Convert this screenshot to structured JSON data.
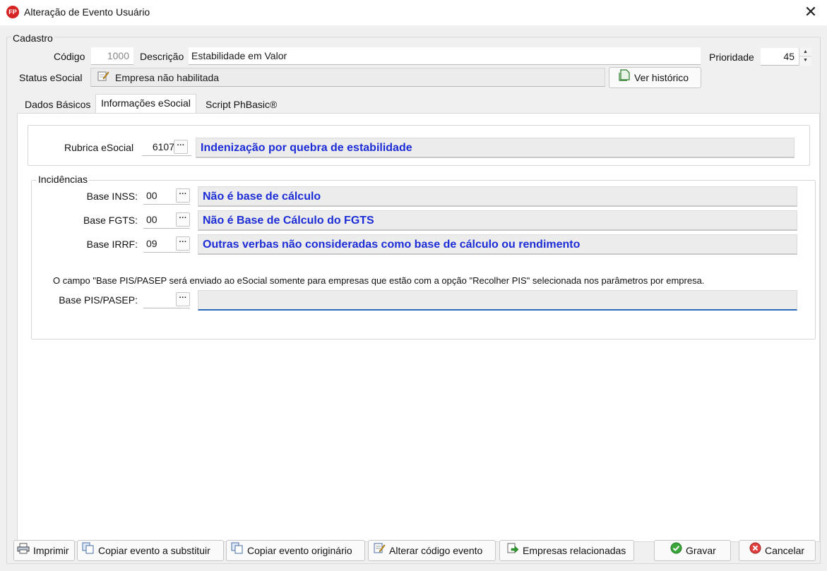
{
  "window": {
    "title": "Alteração de Evento Usuário",
    "app_icon_text": "FP"
  },
  "cadastro": {
    "group_label": "Cadastro",
    "codigo_label": "Código",
    "codigo_value": "1000",
    "descricao_label": "Descrição",
    "descricao_value": "Estabilidade em Valor",
    "prioridade_label": "Prioridade",
    "prioridade_value": "45",
    "status_label": "Status eSocial",
    "status_value": "Empresa não habilitada",
    "ver_historico_label": "Ver histórico"
  },
  "tabs": [
    {
      "label": "Dados Básicos",
      "active": false
    },
    {
      "label": "Informações eSocial",
      "active": true
    },
    {
      "label": "Script PhBasic®",
      "active": false
    }
  ],
  "esocial": {
    "rubrica_label": "Rubrica eSocial",
    "rubrica_code": "6107",
    "rubrica_desc": "Indenização por quebra de estabilidade",
    "incidencias_label": "Incidências",
    "inss_label": "Base INSS:",
    "inss_code": "00",
    "inss_desc": "Não é base de cálculo",
    "fgts_label": "Base FGTS:",
    "fgts_code": "00",
    "fgts_desc": "Não é Base de Cálculo do FGTS",
    "irrf_label": "Base IRRF:",
    "irrf_code": "09",
    "irrf_desc": "Outras verbas não consideradas como base de cálculo ou rendimento",
    "pis_note": "O campo \"Base PIS/PASEP será enviado ao eSocial somente para empresas que estão com a opção \"Recolher PIS\" selecionada nos parâmetros por empresa.",
    "pis_label": "Base PIS/PASEP:",
    "pis_code": "",
    "pis_desc": "",
    "ellipsis": "···"
  },
  "footer": {
    "imprimir": "Imprimir",
    "copiar_substituir": "Copiar evento a substituir",
    "copiar_originario": "Copiar evento originário",
    "alterar_codigo": "Alterar código evento",
    "empresas_relacionadas": "Empresas relacionadas",
    "gravar": "Gravar",
    "cancelar": "Cancelar"
  },
  "colors": {
    "blue_desc": "#1c2cd6",
    "client_bg": "#f0f0f0",
    "app_icon": "#d62424"
  }
}
